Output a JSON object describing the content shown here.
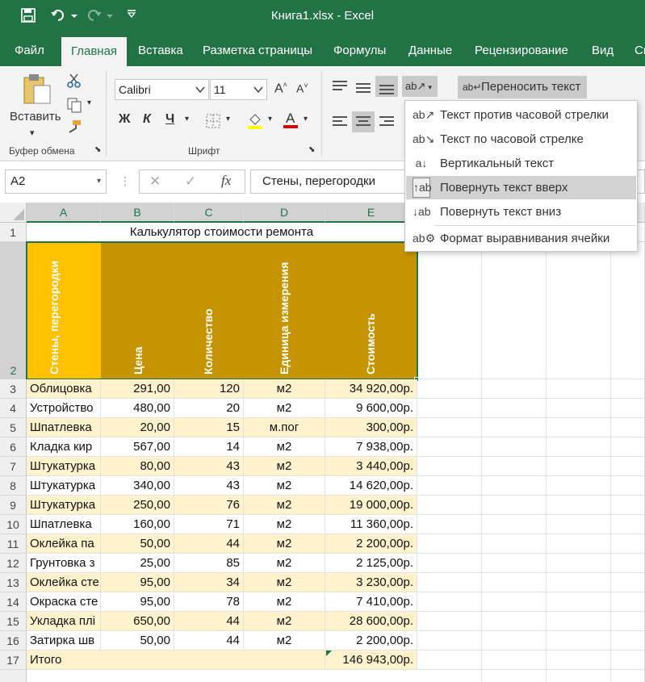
{
  "titlebar": {
    "title": "Книга1.xlsx  -  Excel",
    "bg": "#217346"
  },
  "tabs": [
    "Файл",
    "Главная",
    "Вставка",
    "Разметка страницы",
    "Формулы",
    "Данные",
    "Рецензирование",
    "Вид",
    "Сп"
  ],
  "ribbon": {
    "clipboard_group": "Буфер обмена",
    "paste_label": "Вставить",
    "font_group": "Шрифт",
    "font_name": "Calibri",
    "font_size": "11",
    "bold": "Ж",
    "italic": "К",
    "underline": "Ч",
    "wrap_text": "Переносить текст"
  },
  "formula_bar": {
    "name_box": "A2",
    "formula": "Стены, перегородки",
    "fx": "fx"
  },
  "orientation_menu": {
    "items": [
      {
        "label": "Текст против часовой стрелки",
        "icon": "ab-ccw-icon",
        "glyph": "ab↗"
      },
      {
        "label": "Текст по часовой стрелке",
        "icon": "ab-cw-icon",
        "glyph": "ab↘"
      },
      {
        "label": "Вертикальный текст",
        "icon": "vertical-text-icon",
        "glyph": "a↓"
      },
      {
        "label": "Повернуть текст вверх",
        "icon": "rotate-up-icon",
        "glyph": "↑ab"
      },
      {
        "label": "Повернуть текст вниз",
        "icon": "rotate-down-icon",
        "glyph": "↓ab"
      },
      {
        "label": "Формат выравнивания ячейки",
        "icon": "format-alignment-icon",
        "glyph": "ab⚙"
      }
    ]
  },
  "sheet": {
    "columns": [
      "A",
      "B",
      "C",
      "D",
      "E"
    ],
    "row1_title": "Калькулятор стоимости ремонта",
    "headers": [
      "Стены, перегородки",
      "Цена",
      "Количество",
      "Единица измерения",
      "Стоимость"
    ],
    "rows": [
      {
        "n": "3",
        "a": "Облицовка",
        "b": "291,00",
        "c": "120",
        "d": "м2",
        "e": "34 920,00р."
      },
      {
        "n": "4",
        "a": "Устройство",
        "b": "480,00",
        "c": "20",
        "d": "м2",
        "e": "9 600,00р."
      },
      {
        "n": "5",
        "a": "Шпатлевка",
        "b": "20,00",
        "c": "15",
        "d": "м.пог",
        "e": "300,00р."
      },
      {
        "n": "6",
        "a": "Кладка кир",
        "b": "567,00",
        "c": "14",
        "d": "м2",
        "e": "7 938,00р."
      },
      {
        "n": "7",
        "a": "Штукатурка",
        "b": "80,00",
        "c": "43",
        "d": "м2",
        "e": "3 440,00р."
      },
      {
        "n": "8",
        "a": "Штукатурка",
        "b": "340,00",
        "c": "43",
        "d": "м2",
        "e": "14 620,00р."
      },
      {
        "n": "9",
        "a": "Штукатурка",
        "b": "250,00",
        "c": "76",
        "d": "м2",
        "e": "19 000,00р."
      },
      {
        "n": "10",
        "a": "Шпатлевка",
        "b": "160,00",
        "c": "71",
        "d": "м2",
        "e": "11 360,00р."
      },
      {
        "n": "11",
        "a": "Оклейка па",
        "b": "50,00",
        "c": "44",
        "d": "м2",
        "e": "2 200,00р."
      },
      {
        "n": "12",
        "a": "Грунтовка з",
        "b": "25,00",
        "c": "85",
        "d": "м2",
        "e": "2 125,00р."
      },
      {
        "n": "13",
        "a": "Оклейка сте",
        "b": "95,00",
        "c": "34",
        "d": "м2",
        "e": "3 230,00р."
      },
      {
        "n": "14",
        "a": "Окраска сте",
        "b": "95,00",
        "c": "78",
        "d": "м2",
        "e": "7 410,00р."
      },
      {
        "n": "15",
        "a": "Укладка плі",
        "b": "650,00",
        "c": "44",
        "d": "м2",
        "e": "28 600,00р."
      },
      {
        "n": "16",
        "a": "Затирка шв",
        "b": "50,00",
        "c": "44",
        "d": "м2",
        "e": "2 200,00р."
      }
    ],
    "total_row": {
      "n": "17",
      "label": "Итого",
      "value": "146 943,00р."
    },
    "colors": {
      "header_a": "#ffc000",
      "header_rest": "#c69400",
      "band": "#fff2cc",
      "accent": "#217346"
    }
  }
}
